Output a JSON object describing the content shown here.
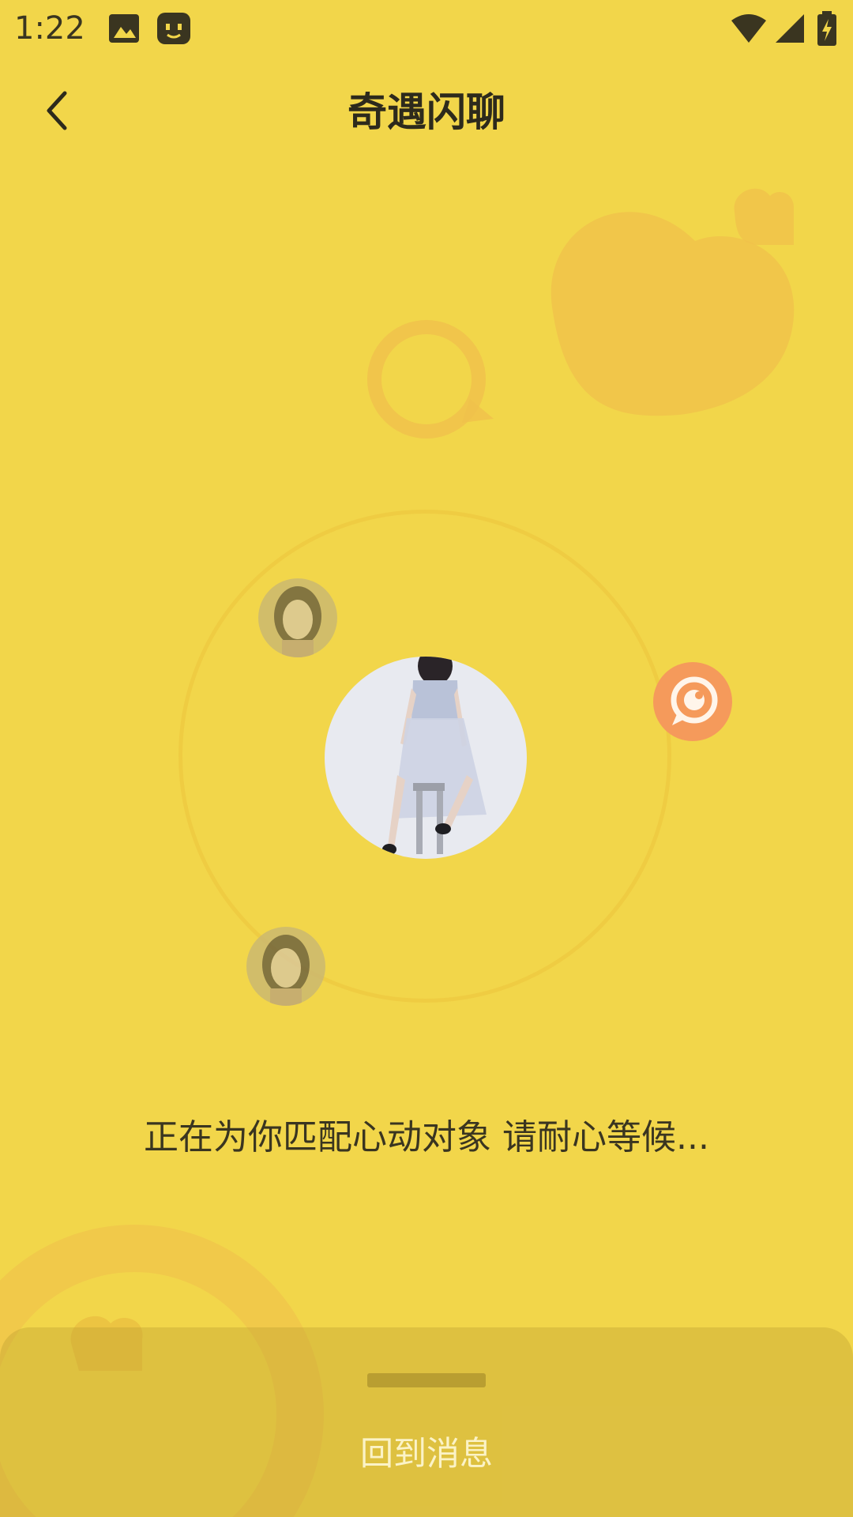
{
  "status_bar": {
    "time": "1:22",
    "icons": [
      "image-icon",
      "app-notification-icon",
      "wifi-icon",
      "cell-signal-icon",
      "battery-charging-icon"
    ]
  },
  "header": {
    "title": "奇遇闪聊",
    "back_icon": "chevron-left-icon"
  },
  "matching": {
    "status_text": "正在为你匹配心动对象 请耐心等候...",
    "action_icon": "chat-bubble-icon"
  },
  "bottom_sheet": {
    "return_label": "回到消息"
  },
  "colors": {
    "background": "#F2D64A",
    "accent_orange": "#F59A5B",
    "text_dark": "#2d2a1c"
  }
}
